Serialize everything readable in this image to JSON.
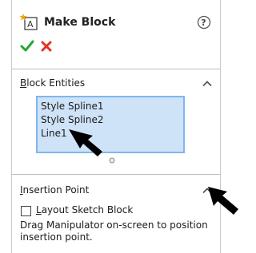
{
  "header": {
    "title": "Make Block",
    "icons": {
      "feature": "make-block-icon",
      "help": "help-icon",
      "ok": "checkmark-icon",
      "cancel": "close-icon"
    },
    "colors": {
      "ok": "#2aa532",
      "cancel": "#e53223"
    }
  },
  "block_entities": {
    "title_accesskey": "B",
    "title_rest": "lock Entities",
    "items": [
      "Style Spline1",
      "Style Spline2",
      "Line1"
    ],
    "selection_color": "#cfe3f8",
    "border_color": "#7fb6ee"
  },
  "insertion_point": {
    "title_accesskey": "I",
    "title_rest": "nsertion Point",
    "checkbox": {
      "label_accesskey": "L",
      "label_rest": "ayout Sketch Block",
      "checked": false
    },
    "help_text": "Drag Manipulator on-screen to position insertion point."
  }
}
